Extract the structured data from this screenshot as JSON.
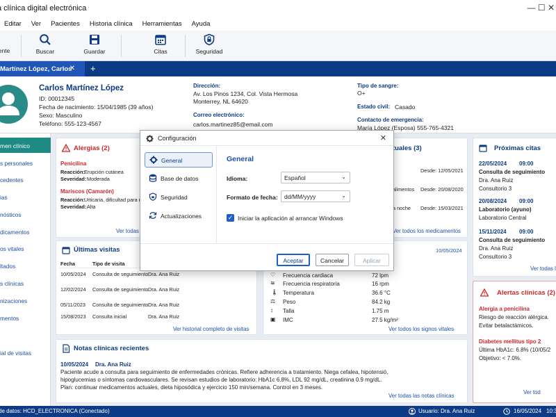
{
  "window": {
    "title": "a clínica digital electrónica",
    "controls": "—   ☐   ✕"
  },
  "menu": [
    "Editar",
    "Ver",
    "Pacientes",
    "Historia clínica",
    "Herramientas",
    "Ayuda"
  ],
  "toolbar": {
    "items": [
      {
        "label": "ente",
        "icon": "new-icon"
      },
      {
        "label": "Buscar",
        "icon": "search-icon"
      },
      {
        "label": "Guardar",
        "icon": "save-icon"
      },
      {
        "label": "Citas",
        "icon": "calendar-icon"
      },
      {
        "label": "Seguridad",
        "icon": "shield-lock-icon"
      }
    ]
  },
  "tabs": {
    "active": "Martínez López, Carlos",
    "close": "✕",
    "add": "+"
  },
  "patient": {
    "name": "Carlos Martínez López",
    "id": "ID: 00012345",
    "dob": "Fecha de nacimiento: 15/04/1985 (39 años)",
    "sex": "Sexo: Masculino",
    "phone": "Teléfono:   555-123-4567",
    "address_label": "Dirección:",
    "address_1": "Av. Los Pinos 1234, Col. Vista Hermosa",
    "address_2": "Monterrey, NL 64620",
    "email_label": "Correo electrónico:",
    "email": "carlos.martinez85@email.com",
    "blood_label": "Tipo de sangre:",
    "blood": "O+",
    "civil_label": "Estado civil:",
    "civil": "Casado",
    "emergency_label": "Contacto de emergencia:",
    "emergency": "María López (Esposa)   555-765-4321"
  },
  "sidebar": {
    "active": "men clínico",
    "items": [
      "s personales",
      "cedentes",
      "ias",
      "nósticos",
      "dicamentos",
      "os vitales",
      "ltados",
      "s clínicas",
      "nizaciones",
      "mentos",
      "ial de visitas"
    ]
  },
  "allergies": {
    "title": "Alergias (2)",
    "items": [
      {
        "name": "Penicilina",
        "reaction_label": "Reacción:",
        "reaction": "Erupción cutánea",
        "severity_label": "Severidad:",
        "severity": "Moderada"
      },
      {
        "name": "Mariscos (Camarón)",
        "reaction_label": "Reacción:",
        "reaction": "Urticaria, dificultad para re",
        "severity_label": "Severidad:",
        "severity": "Alta"
      }
    ],
    "link": "Ver todas l"
  },
  "medications": {
    "title": "tuales (3)",
    "rows": [
      {
        "text": "",
        "since": "Desde: 12/05/2021"
      },
      {
        "text": "alimentos",
        "since": "Desde: 20/08/2020"
      },
      {
        "text": "a noche",
        "since": "Desde: 15/03/2021"
      }
    ],
    "link": "Ver todos los medicamentos"
  },
  "appointments": {
    "title": "Próximas citas",
    "items": [
      {
        "date": "22/05/2024",
        "time": "09:00",
        "type": "Consulta de seguimiento",
        "doctor": "Dra. Ana Ruiz",
        "place": "Consultorio 3"
      },
      {
        "date": "20/08/2024",
        "time": "09:00",
        "type": "Laboratorio (ayuno)",
        "doctor": "Laboratorio Central",
        "place": ""
      },
      {
        "date": "15/11/2024",
        "time": "09:00",
        "type": "Consulta de seguimiento",
        "doctor": "Dra. Ana Ruiz",
        "place": "Consultorio 3"
      }
    ],
    "link": "Ver todas l"
  },
  "visits": {
    "title": "Últimas visitas",
    "headers": [
      "Fecha",
      "Tipo de visita"
    ],
    "rows": [
      {
        "date": "10/05/2024",
        "type": "Consulta de seguimiento",
        "doctor": "Dra. Ana Ruiz"
      },
      {
        "date": "12/02/2024",
        "type": "Consulta de seguimiento",
        "doctor": "Dra. Ana Ruiz"
      },
      {
        "date": "05/11/2023",
        "type": "Consulta de seguimiento",
        "doctor": "Dra. Ana Ruiz"
      },
      {
        "date": "15/08/2023",
        "type": "Consulta inicial",
        "doctor": "Dra. Ana Ruiz"
      }
    ],
    "link": "Ver historial completo de visitas"
  },
  "vitals": {
    "date": "10/05/2024",
    "rows": [
      {
        "label": "Frecuencia cardiaca",
        "value": "72 lpm"
      },
      {
        "label": "Frecuencia respiratoria",
        "value": "16 rpm"
      },
      {
        "label": "Temperatura",
        "value": "36.6 °C"
      },
      {
        "label": "Peso",
        "value": "84.2 kg"
      },
      {
        "label": "Talla",
        "value": "1.75 m"
      },
      {
        "label": "IMC",
        "value": "27.5 kg/m²"
      }
    ],
    "link": "Ver todos los signos vitales"
  },
  "alerts": {
    "title": "Alertas clínicas (2)",
    "items": [
      {
        "title": "Alergia a penicilina",
        "lines": [
          "Riesgo de reacción alérgica.",
          "Evitar betalactámicos."
        ]
      },
      {
        "title": "Diabetes mellitus tipo 2",
        "lines": [
          "Última HbA1c: 6.8% (10/05/2",
          "Objetivo: < 7.0%."
        ]
      }
    ],
    "link": "Ver tod"
  },
  "notes": {
    "title": "Notas clínicas recientes",
    "date": "10/05/2024",
    "doctor": "Dra. Ana Ruiz",
    "lines": [
      "Paciente acude a consulta para seguimiento de enfermedades crónicas. Refiere adherencia a tratamiento. Niega cefalea, hipotensió,",
      "hipoglucemias o síntomas cardiovasculares. Se revisan estudios de laboratorio: HbA1c 6.8%, LDL 92 mg/dL, creatinina 0.9 mg/dL.",
      "Plan: continuar medicamentos actuales, dieta hiposódica y ejercicio 150 min/semana. Control en 3 meses."
    ],
    "link": "Ver todas las notas clínicas"
  },
  "status": {
    "db": "de datos: HCD_ELECTRONICA (Conectado)",
    "user": "Usuario: Dra. Ana Ruiz",
    "date": "16/05/2024",
    "time": "10:3"
  },
  "dialog": {
    "title": "Configuración",
    "close": "✕",
    "nav": [
      "General",
      "Base de datos",
      "Seguridad",
      "Actualizaciones"
    ],
    "section": "General",
    "language_label": "Idioma:",
    "language": "Español",
    "date_format_label": "Formato de fecha:",
    "date_format": "dd/MM/yyyy",
    "startup_checked": true,
    "startup_label": "Iniciar la aplicación al arrancar Windows",
    "ok": "Aceptar",
    "cancel": "Cancelar",
    "apply": "Aplicar"
  },
  "colors": {
    "primary": "#0d3b86",
    "accent": "#1d5ec7",
    "teal": "#1e8a83",
    "danger": "#d0282c"
  }
}
